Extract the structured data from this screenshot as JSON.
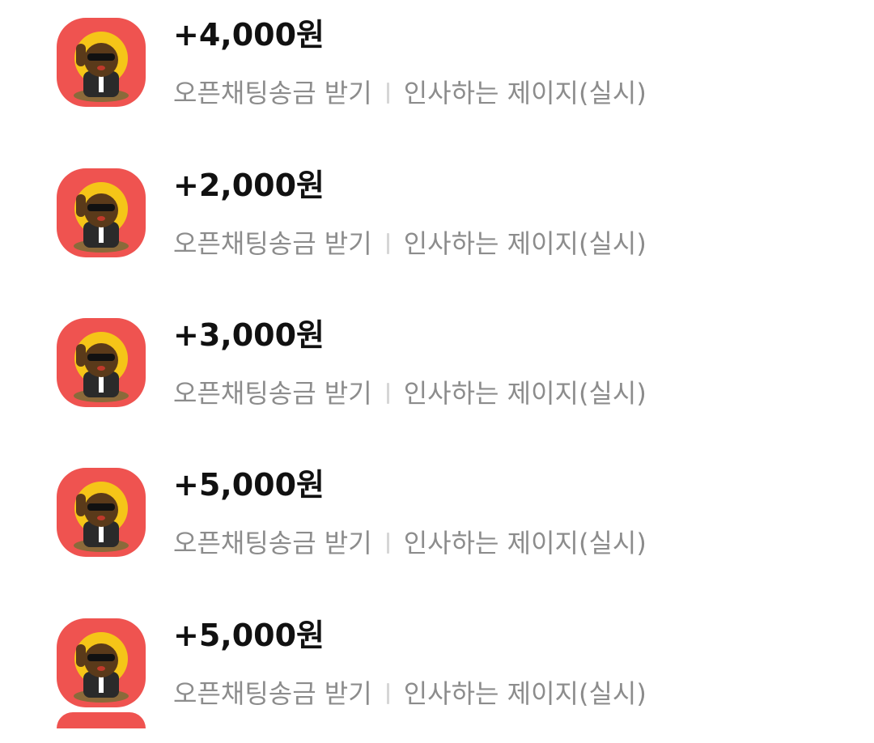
{
  "colors": {
    "avatar_bg": "#ef5350",
    "avatar_halo": "#f5c518",
    "amount_text": "#111111",
    "meta_text": "#8c8c8c",
    "separator": "#d6d6d6"
  },
  "transactions": [
    {
      "amount": "+4,000원",
      "type": "오픈채팅송금 받기",
      "room": "인사하는 제이지(실시)",
      "icon": "jay-g-character-icon"
    },
    {
      "amount": "+2,000원",
      "type": "오픈채팅송금 받기",
      "room": "인사하는 제이지(실시)",
      "icon": "jay-g-character-icon"
    },
    {
      "amount": "+3,000원",
      "type": "오픈채팅송금 받기",
      "room": "인사하는 제이지(실시)",
      "icon": "jay-g-character-icon"
    },
    {
      "amount": "+5,000원",
      "type": "오픈채팅송금 받기",
      "room": "인사하는 제이지(실시)",
      "icon": "jay-g-character-icon"
    },
    {
      "amount": "+5,000원",
      "type": "오픈채팅송금 받기",
      "room": "인사하는 제이지(실시)",
      "icon": "jay-g-character-icon"
    }
  ]
}
